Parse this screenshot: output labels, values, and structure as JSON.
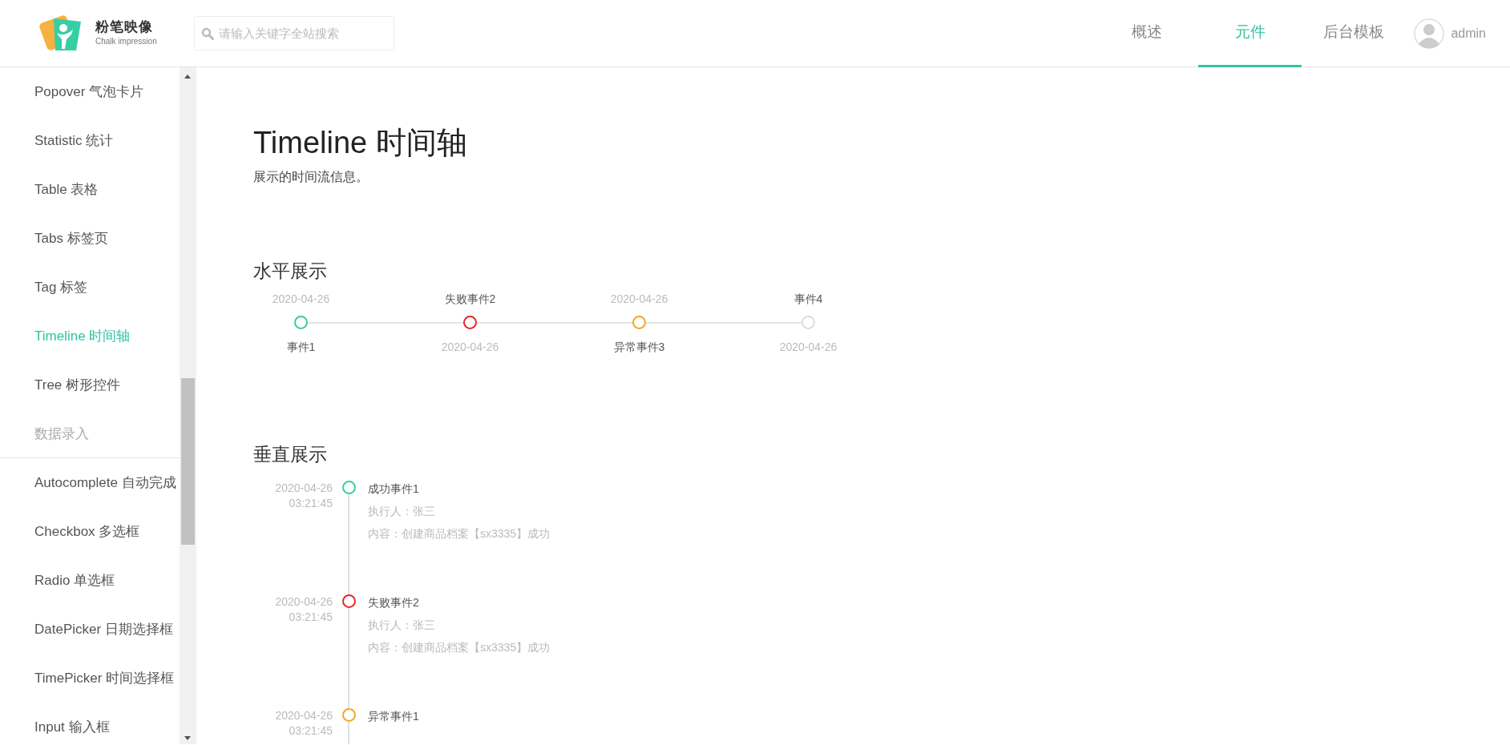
{
  "header": {
    "logo": {
      "name": "粉笔映像",
      "tagline": "Chalk impression"
    },
    "search": {
      "placeholder": "请输入关键字全站搜索"
    },
    "nav": [
      {
        "label": "概述",
        "selected": false
      },
      {
        "label": "元件",
        "selected": true
      },
      {
        "label": "后台模板",
        "selected": false
      }
    ],
    "user": {
      "name": "admin"
    }
  },
  "sidebar": {
    "items": [
      {
        "kind": "link",
        "label": "Popover 气泡卡片",
        "selected": false
      },
      {
        "kind": "link",
        "label": "Statistic 统计",
        "selected": false
      },
      {
        "kind": "link",
        "label": "Table 表格",
        "selected": false
      },
      {
        "kind": "link",
        "label": "Tabs 标签页",
        "selected": false
      },
      {
        "kind": "link",
        "label": "Tag 标签",
        "selected": false
      },
      {
        "kind": "link",
        "label": "Timeline 时间轴",
        "selected": true
      },
      {
        "kind": "link",
        "label": "Tree 树形控件",
        "selected": false
      },
      {
        "kind": "group",
        "label": "数据录入"
      },
      {
        "kind": "link",
        "label": "Autocomplete 自动完成",
        "selected": false
      },
      {
        "kind": "link",
        "label": "Checkbox 多选框",
        "selected": false
      },
      {
        "kind": "link",
        "label": "Radio 单选框",
        "selected": false
      },
      {
        "kind": "link",
        "label": "DatePicker 日期选择框",
        "selected": false
      },
      {
        "kind": "link",
        "label": "TimePicker 时间选择框",
        "selected": false
      },
      {
        "kind": "link",
        "label": "Input 输入框",
        "selected": false
      }
    ]
  },
  "page": {
    "title": "Timeline 时间轴",
    "description": "展示的时间流信息。"
  },
  "horizontal": {
    "heading": "水平展示",
    "items": [
      {
        "date": "2020-04-26",
        "title": "事件1",
        "date_above": true,
        "color": "#36cfa5"
      },
      {
        "date": "2020-04-26",
        "title": "失败事件2",
        "date_above": false,
        "color": "#e8262d"
      },
      {
        "date": "2020-04-26",
        "title": "异常事件3",
        "date_above": true,
        "color": "#f5a623"
      },
      {
        "date": "2020-04-26",
        "title": "事件4",
        "date_above": false,
        "color": "#dddddd"
      }
    ]
  },
  "vertical": {
    "heading": "垂直展示",
    "items": [
      {
        "date": "2020-04-26",
        "time": "03:21:45",
        "title": "成功事件1",
        "color": "#36cfa5",
        "details": [
          "执行人：张三",
          "内容：创建商品档案【sx3335】成功"
        ]
      },
      {
        "date": "2020-04-26",
        "time": "03:21:45",
        "title": "失败事件2",
        "color": "#e8262d",
        "details": [
          "执行人：张三",
          "内容：创建商品档案【sx3335】成功"
        ]
      },
      {
        "date": "2020-04-26",
        "time": "03:21:45",
        "title": "异常事件1",
        "color": "#f5a623"
      }
    ]
  }
}
